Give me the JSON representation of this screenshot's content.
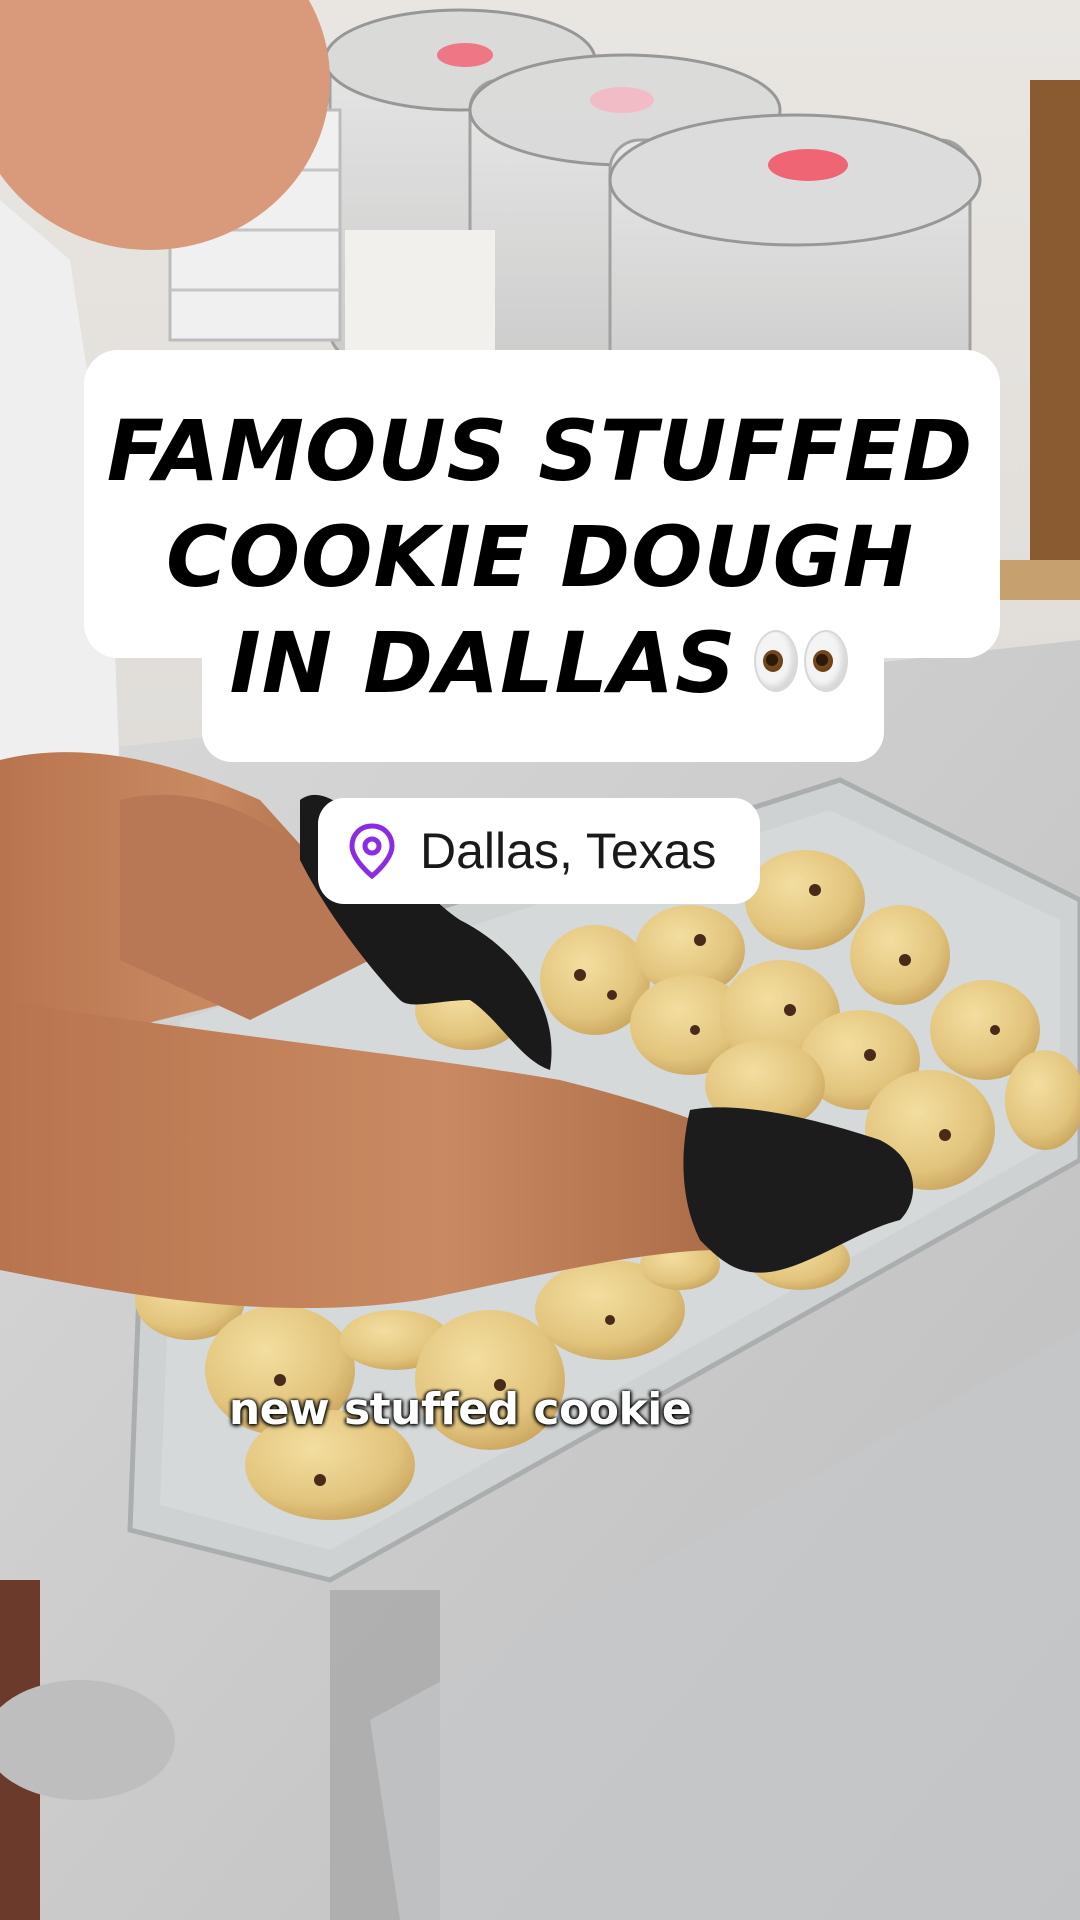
{
  "video": {
    "title_lines": [
      "FAMOUS STUFFED",
      "COOKIE DOUGH",
      "IN DALLAS"
    ],
    "title_emoji": "eyes-emoji",
    "location": {
      "icon": "location-pin-icon",
      "label": "Dallas, Texas",
      "icon_color": "#8B2BE2"
    },
    "caption": "new stuffed cookie"
  },
  "colors": {
    "caption_background": "#ffffff",
    "title_text": "#000000"
  }
}
